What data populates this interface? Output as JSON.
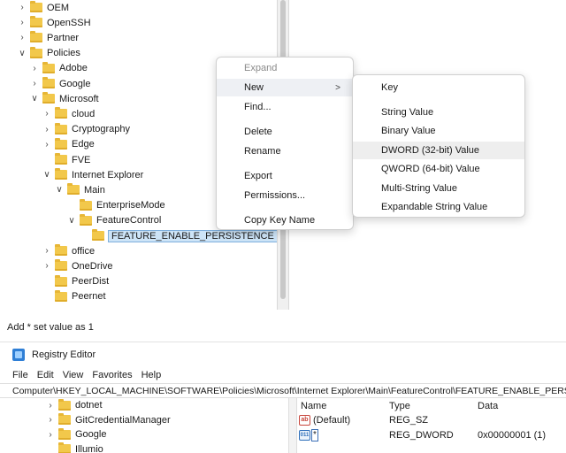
{
  "top": {
    "tree": [
      {
        "label": "OEM",
        "chevron": ">",
        "indent": 0
      },
      {
        "label": "OpenSSH",
        "chevron": ">",
        "indent": 0
      },
      {
        "label": "Partner",
        "chevron": ">",
        "indent": 0
      },
      {
        "label": "Policies",
        "chevron": "v",
        "indent": 0
      },
      {
        "label": "Adobe",
        "chevron": ">",
        "indent": 1
      },
      {
        "label": "Google",
        "chevron": ">",
        "indent": 1
      },
      {
        "label": "Microsoft",
        "chevron": "v",
        "indent": 1
      },
      {
        "label": "cloud",
        "chevron": ">",
        "indent": 2
      },
      {
        "label": "Cryptography",
        "chevron": ">",
        "indent": 2
      },
      {
        "label": "Edge",
        "chevron": ">",
        "indent": 2
      },
      {
        "label": "FVE",
        "chevron": "",
        "indent": 2
      },
      {
        "label": "Internet Explorer",
        "chevron": "v",
        "indent": 2
      },
      {
        "label": "Main",
        "chevron": "v",
        "indent": 3
      },
      {
        "label": "EnterpriseMode",
        "chevron": "",
        "indent": 4
      },
      {
        "label": "FeatureControl",
        "chevron": "v",
        "indent": 4
      },
      {
        "label": "FEATURE_ENABLE_PERSISTENCE",
        "chevron": "",
        "indent": 5,
        "selected": true
      },
      {
        "label": "office",
        "chevron": ">",
        "indent": 2
      },
      {
        "label": "OneDrive",
        "chevron": ">",
        "indent": 2
      },
      {
        "label": "PeerDist",
        "chevron": "",
        "indent": 2
      },
      {
        "label": "Peernet",
        "chevron": "",
        "indent": 2
      }
    ],
    "context_menu": [
      {
        "label": "Expand",
        "disabled": true
      },
      {
        "label": "New",
        "submenu": true,
        "hover": true
      },
      {
        "label": "Find..."
      },
      {
        "label": "Delete"
      },
      {
        "label": "Rename"
      },
      {
        "label": "Export"
      },
      {
        "label": "Permissions..."
      },
      {
        "label": "Copy Key Name"
      }
    ],
    "context_arrow": ">",
    "submenu": [
      {
        "label": "Key"
      },
      {
        "label": "String Value"
      },
      {
        "label": "Binary Value"
      },
      {
        "label": "DWORD (32-bit) Value",
        "hover": true
      },
      {
        "label": "QWORD (64-bit) Value"
      },
      {
        "label": "Multi-String Value"
      },
      {
        "label": "Expandable String Value"
      }
    ]
  },
  "caption": "Add * set value as 1",
  "regedit": {
    "title": "Registry Editor",
    "menus": [
      "File",
      "Edit",
      "View",
      "Favorites",
      "Help"
    ],
    "address": "Computer\\HKEY_LOCAL_MACHINE\\SOFTWARE\\Policies\\Microsoft\\Internet Explorer\\Main\\FeatureControl\\FEATURE_ENABLE_PERSISTENCE",
    "tree": [
      {
        "label": "dotnet",
        "chevron": ">"
      },
      {
        "label": "GitCredentialManager",
        "chevron": ">"
      },
      {
        "label": "Google",
        "chevron": ">"
      },
      {
        "label": "Illumio",
        "chevron": ""
      }
    ],
    "columns": {
      "name": "Name",
      "type": "Type",
      "data": "Data"
    },
    "values": [
      {
        "name": "(Default)",
        "type": "REG_SZ",
        "data": "",
        "icon": "string-value-icon"
      },
      {
        "name": "*",
        "type": "REG_DWORD",
        "data": "0x00000001 (1)",
        "icon": "dword-value-icon"
      }
    ],
    "icon_text": {
      "string": "ab",
      "dword": "011"
    }
  },
  "colors": {
    "folder": "#f2c84b",
    "selection": "#cde4f7",
    "menu_hover": "#eef0f4"
  }
}
